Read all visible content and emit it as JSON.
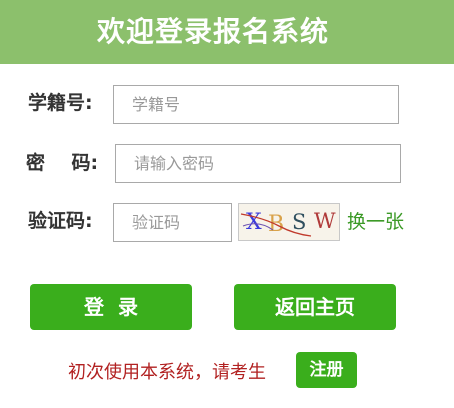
{
  "header": {
    "title": "欢迎登录报名系统"
  },
  "form": {
    "student_id": {
      "label": "学籍号:",
      "placeholder": "学籍号",
      "value": ""
    },
    "password": {
      "label": "密    码:",
      "placeholder": "请输入密码",
      "value": ""
    },
    "captcha": {
      "label": "验证码:",
      "placeholder": "验证码",
      "value": "",
      "image_text": [
        "X",
        "B",
        "S",
        "W"
      ],
      "refresh_label": "换一张"
    }
  },
  "actions": {
    "login_label": "登  录",
    "home_label": "返回主页"
  },
  "register": {
    "prompt": "初次使用本系统，请考生",
    "button_label": "注册"
  },
  "colors": {
    "header_bg": "#8cc06c",
    "button_bg": "#3aae1c",
    "link": "#3c9a27",
    "prompt_text": "#b22222"
  }
}
